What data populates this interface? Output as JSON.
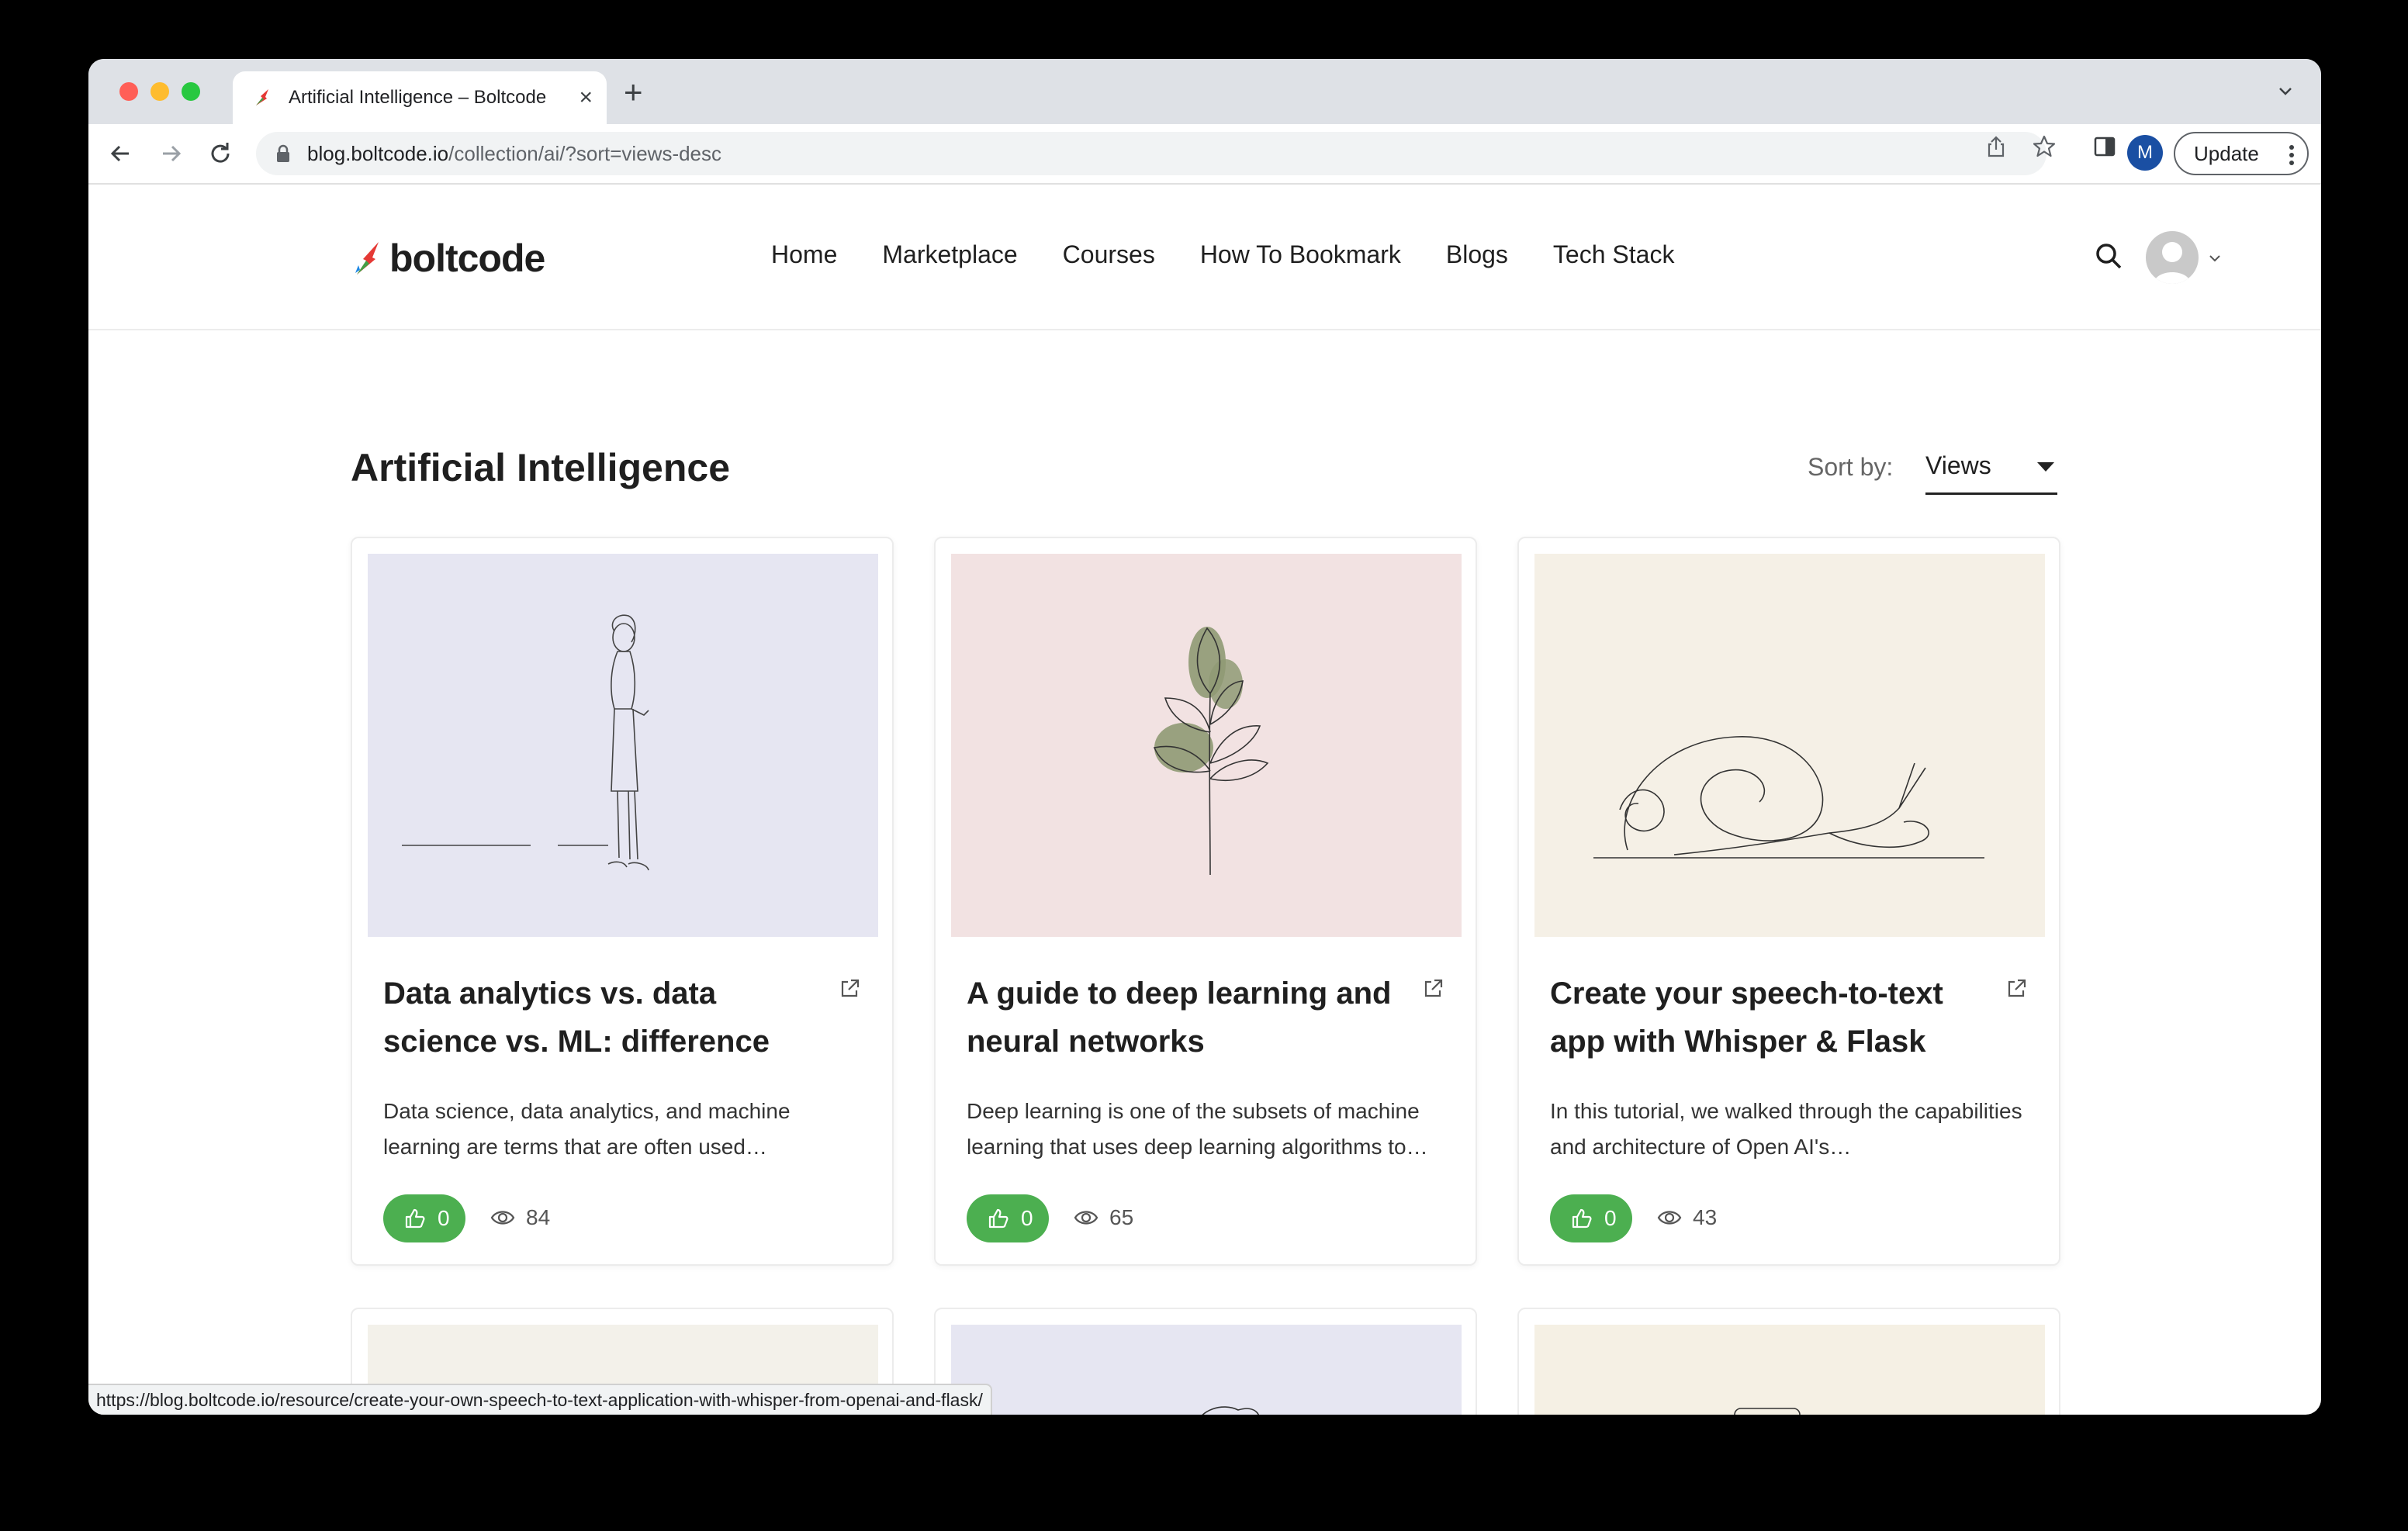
{
  "browser": {
    "tab_title": "Artificial Intelligence – Boltcode",
    "url_host": "blog.boltcode.io",
    "url_path": "/collection/ai/?sort=views-desc",
    "profile_initial": "M",
    "update_label": "Update",
    "status_url": "https://blog.boltcode.io/resource/create-your-own-speech-to-text-application-with-whisper-from-openai-and-flask/"
  },
  "site": {
    "logo_text": "boltcode",
    "nav": [
      "Home",
      "Marketplace",
      "Courses",
      "How To Bookmark",
      "Blogs",
      "Tech Stack"
    ]
  },
  "main": {
    "title": "Artificial Intelligence",
    "sort_label": "Sort by:",
    "sort_value": "Views",
    "cards": [
      {
        "title": "Data analytics vs. data science vs. ML: difference",
        "desc": "Data science, data analytics, and machine learning are terms that are often used…",
        "likes": "0",
        "views": "84",
        "thumb_color": "#e6e6f2"
      },
      {
        "title": "A guide to deep learning and neural networks",
        "desc": "Deep learning is one of the subsets of machine learning that uses deep learning algorithms to…",
        "likes": "0",
        "views": "65",
        "thumb_color": "#f2e2e2"
      },
      {
        "title": "Create your speech-to-text app with Whisper & Flask",
        "desc": "In this tutorial, we walked through the capabilities and architecture of Open AI's…",
        "likes": "0",
        "views": "43",
        "thumb_color": "#f5f0e6"
      }
    ],
    "next_row_thumb_colors": [
      "#f3f1ea",
      "#e6e6f2",
      "#f5f0e4"
    ]
  },
  "colors": {
    "accent_green": "#4caf50",
    "chrome_bg": "#dee1e6"
  }
}
